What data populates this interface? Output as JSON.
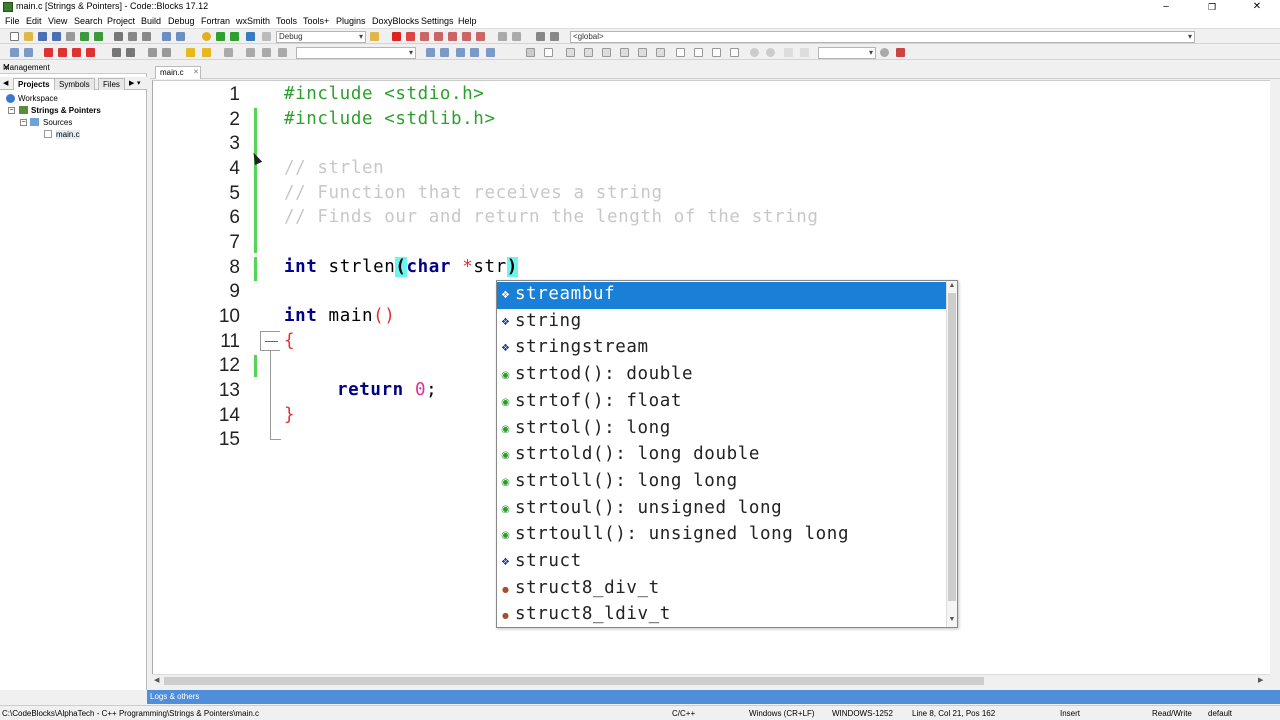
{
  "window": {
    "title": "main.c [Strings & Pointers] - Code::Blocks 17.12",
    "minimize": "–",
    "maximize": "❐",
    "close": "✕"
  },
  "menu": [
    "File",
    "Edit",
    "View",
    "Search",
    "Project",
    "Build",
    "Debug",
    "Fortran",
    "wxSmith",
    "Tools",
    "Tools+",
    "Plugins",
    "DoxyBlocks",
    "Settings",
    "Help"
  ],
  "toolbar": {
    "build_target": "Debug",
    "scope": "<global>"
  },
  "management": {
    "title": "Management",
    "close": "✕",
    "tabs": [
      "Projects",
      "Symbols",
      "Files"
    ],
    "tree": {
      "workspace": "Workspace",
      "project": "Strings & Pointers",
      "folder": "Sources",
      "file": "main.c"
    }
  },
  "editor": {
    "tab": "main.c",
    "tab_close": "✕",
    "line_numbers": [
      "1",
      "2",
      "3",
      "4",
      "5",
      "6",
      "7",
      "8",
      "9",
      "10",
      "11",
      "12",
      "13",
      "14",
      "15"
    ],
    "lines": {
      "l1": "#include <stdio.h>",
      "l2": "#include <stdlib.h>",
      "l4": "// strlen",
      "l5": "// Function that receives a string",
      "l6": "// Finds our and return the length of the string",
      "l8_kw1": "int",
      "l8_fn": " strlen",
      "l8_paren_open": "(",
      "l8_kw2": "char",
      "l8_star": " *",
      "l8_arg": "str",
      "l8_paren_close": ")",
      "l10_kw": "int",
      "l10_fn": " main",
      "l10_parens": "()",
      "l11": "{",
      "l13_kw": "return",
      "l13_num": "0",
      "l13_semi": ";",
      "l14": "}"
    }
  },
  "autocomplete": {
    "items": [
      {
        "icon": "class-icon",
        "glyph": "❖",
        "color": "#1a3a8a",
        "text": "streambuf",
        "selected": true
      },
      {
        "icon": "class-icon",
        "glyph": "❖",
        "color": "#1a3a8a",
        "text": "string"
      },
      {
        "icon": "class-icon",
        "glyph": "❖",
        "color": "#1a3a8a",
        "text": "stringstream"
      },
      {
        "icon": "function-icon",
        "glyph": "◉",
        "color": "#2e9a2e",
        "text": "strtod(): double"
      },
      {
        "icon": "function-icon",
        "glyph": "◉",
        "color": "#2e9a2e",
        "text": "strtof(): float"
      },
      {
        "icon": "function-icon",
        "glyph": "◉",
        "color": "#2e9a2e",
        "text": "strtol(): long"
      },
      {
        "icon": "function-icon",
        "glyph": "◉",
        "color": "#2e9a2e",
        "text": "strtold(): long double"
      },
      {
        "icon": "function-icon",
        "glyph": "◉",
        "color": "#2e9a2e",
        "text": "strtoll(): long long"
      },
      {
        "icon": "function-icon",
        "glyph": "◉",
        "color": "#2e9a2e",
        "text": "strtoul(): unsigned long"
      },
      {
        "icon": "function-icon",
        "glyph": "◉",
        "color": "#2e9a2e",
        "text": "strtoull(): unsigned long long"
      },
      {
        "icon": "class-icon",
        "glyph": "❖",
        "color": "#1a3a8a",
        "text": "struct"
      },
      {
        "icon": "typedef-icon",
        "glyph": "●",
        "color": "#a0522d",
        "text": "struct8_div_t"
      },
      {
        "icon": "typedef-icon",
        "glyph": "●",
        "color": "#a0522d",
        "text": "struct8_ldiv_t"
      }
    ]
  },
  "logs": {
    "label": "Logs & others"
  },
  "status": {
    "path": "C:\\CodeBlocks\\AlphaTech - C++ Programming\\Strings & Pointers\\main.c",
    "language": "C/C++",
    "eol": "Windows (CR+LF)",
    "encoding": "WINDOWS-1252",
    "position": "Line 8, Col 21, Pos 162",
    "mode": "Insert",
    "access": "Read/Write",
    "profile": "default"
  },
  "colors": {
    "selection": "#1a7fd6",
    "preprocessor": "#2ca02c",
    "keyword": "#00008b",
    "comment": "#c8c8c8",
    "number": "#e0309a",
    "brace_match": "#6cf5f0",
    "change_bar": "#54d654",
    "logs_bar": "#4f8ed8"
  }
}
